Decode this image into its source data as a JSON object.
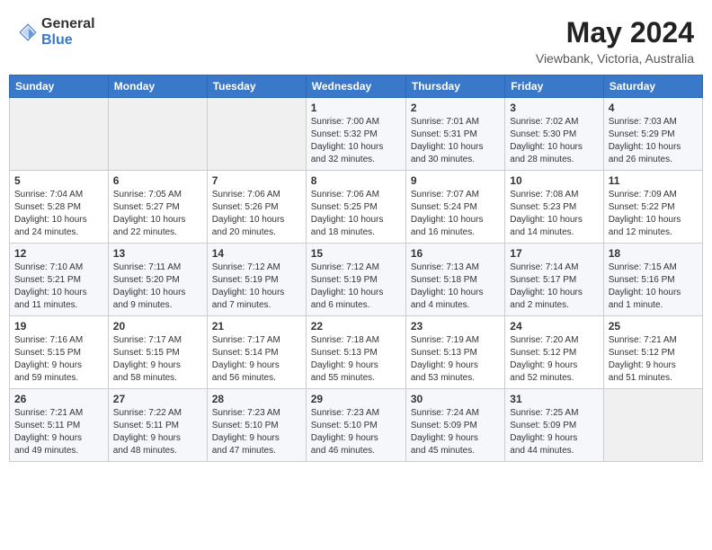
{
  "header": {
    "logo_general": "General",
    "logo_blue": "Blue",
    "title": "May 2024",
    "subtitle": "Viewbank, Victoria, Australia"
  },
  "days_of_week": [
    "Sunday",
    "Monday",
    "Tuesday",
    "Wednesday",
    "Thursday",
    "Friday",
    "Saturday"
  ],
  "weeks": [
    [
      {
        "day": "",
        "info": ""
      },
      {
        "day": "",
        "info": ""
      },
      {
        "day": "",
        "info": ""
      },
      {
        "day": "1",
        "info": "Sunrise: 7:00 AM\nSunset: 5:32 PM\nDaylight: 10 hours\nand 32 minutes."
      },
      {
        "day": "2",
        "info": "Sunrise: 7:01 AM\nSunset: 5:31 PM\nDaylight: 10 hours\nand 30 minutes."
      },
      {
        "day": "3",
        "info": "Sunrise: 7:02 AM\nSunset: 5:30 PM\nDaylight: 10 hours\nand 28 minutes."
      },
      {
        "day": "4",
        "info": "Sunrise: 7:03 AM\nSunset: 5:29 PM\nDaylight: 10 hours\nand 26 minutes."
      }
    ],
    [
      {
        "day": "5",
        "info": "Sunrise: 7:04 AM\nSunset: 5:28 PM\nDaylight: 10 hours\nand 24 minutes."
      },
      {
        "day": "6",
        "info": "Sunrise: 7:05 AM\nSunset: 5:27 PM\nDaylight: 10 hours\nand 22 minutes."
      },
      {
        "day": "7",
        "info": "Sunrise: 7:06 AM\nSunset: 5:26 PM\nDaylight: 10 hours\nand 20 minutes."
      },
      {
        "day": "8",
        "info": "Sunrise: 7:06 AM\nSunset: 5:25 PM\nDaylight: 10 hours\nand 18 minutes."
      },
      {
        "day": "9",
        "info": "Sunrise: 7:07 AM\nSunset: 5:24 PM\nDaylight: 10 hours\nand 16 minutes."
      },
      {
        "day": "10",
        "info": "Sunrise: 7:08 AM\nSunset: 5:23 PM\nDaylight: 10 hours\nand 14 minutes."
      },
      {
        "day": "11",
        "info": "Sunrise: 7:09 AM\nSunset: 5:22 PM\nDaylight: 10 hours\nand 12 minutes."
      }
    ],
    [
      {
        "day": "12",
        "info": "Sunrise: 7:10 AM\nSunset: 5:21 PM\nDaylight: 10 hours\nand 11 minutes."
      },
      {
        "day": "13",
        "info": "Sunrise: 7:11 AM\nSunset: 5:20 PM\nDaylight: 10 hours\nand 9 minutes."
      },
      {
        "day": "14",
        "info": "Sunrise: 7:12 AM\nSunset: 5:19 PM\nDaylight: 10 hours\nand 7 minutes."
      },
      {
        "day": "15",
        "info": "Sunrise: 7:12 AM\nSunset: 5:19 PM\nDaylight: 10 hours\nand 6 minutes."
      },
      {
        "day": "16",
        "info": "Sunrise: 7:13 AM\nSunset: 5:18 PM\nDaylight: 10 hours\nand 4 minutes."
      },
      {
        "day": "17",
        "info": "Sunrise: 7:14 AM\nSunset: 5:17 PM\nDaylight: 10 hours\nand 2 minutes."
      },
      {
        "day": "18",
        "info": "Sunrise: 7:15 AM\nSunset: 5:16 PM\nDaylight: 10 hours\nand 1 minute."
      }
    ],
    [
      {
        "day": "19",
        "info": "Sunrise: 7:16 AM\nSunset: 5:15 PM\nDaylight: 9 hours\nand 59 minutes."
      },
      {
        "day": "20",
        "info": "Sunrise: 7:17 AM\nSunset: 5:15 PM\nDaylight: 9 hours\nand 58 minutes."
      },
      {
        "day": "21",
        "info": "Sunrise: 7:17 AM\nSunset: 5:14 PM\nDaylight: 9 hours\nand 56 minutes."
      },
      {
        "day": "22",
        "info": "Sunrise: 7:18 AM\nSunset: 5:13 PM\nDaylight: 9 hours\nand 55 minutes."
      },
      {
        "day": "23",
        "info": "Sunrise: 7:19 AM\nSunset: 5:13 PM\nDaylight: 9 hours\nand 53 minutes."
      },
      {
        "day": "24",
        "info": "Sunrise: 7:20 AM\nSunset: 5:12 PM\nDaylight: 9 hours\nand 52 minutes."
      },
      {
        "day": "25",
        "info": "Sunrise: 7:21 AM\nSunset: 5:12 PM\nDaylight: 9 hours\nand 51 minutes."
      }
    ],
    [
      {
        "day": "26",
        "info": "Sunrise: 7:21 AM\nSunset: 5:11 PM\nDaylight: 9 hours\nand 49 minutes."
      },
      {
        "day": "27",
        "info": "Sunrise: 7:22 AM\nSunset: 5:11 PM\nDaylight: 9 hours\nand 48 minutes."
      },
      {
        "day": "28",
        "info": "Sunrise: 7:23 AM\nSunset: 5:10 PM\nDaylight: 9 hours\nand 47 minutes."
      },
      {
        "day": "29",
        "info": "Sunrise: 7:23 AM\nSunset: 5:10 PM\nDaylight: 9 hours\nand 46 minutes."
      },
      {
        "day": "30",
        "info": "Sunrise: 7:24 AM\nSunset: 5:09 PM\nDaylight: 9 hours\nand 45 minutes."
      },
      {
        "day": "31",
        "info": "Sunrise: 7:25 AM\nSunset: 5:09 PM\nDaylight: 9 hours\nand 44 minutes."
      },
      {
        "day": "",
        "info": ""
      }
    ]
  ]
}
